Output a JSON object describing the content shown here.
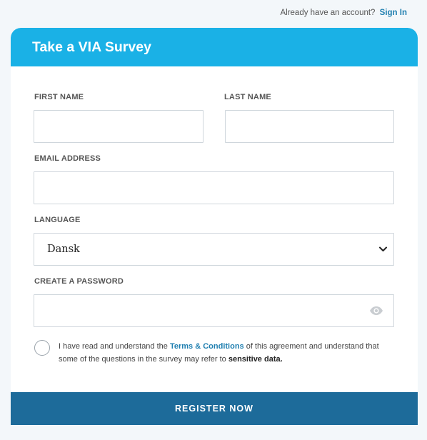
{
  "topbar": {
    "prompt": "Already have an account?",
    "signin_label": "Sign In"
  },
  "form": {
    "title": "Take a VIA Survey",
    "first_name_label": "FIRST NAME",
    "first_name_value": "",
    "last_name_label": "LAST NAME",
    "last_name_value": "",
    "email_label": "EMAIL ADDRESS",
    "email_value": "",
    "language_label": "LANGUAGE",
    "language_value": "Dansk",
    "password_label": "CREATE A PASSWORD",
    "password_value": "",
    "terms_prefix": "I have read and understand the",
    "terms_link": "Terms & Conditions",
    "terms_middle": "of this agreement and understand that some of the questions in the survey may refer to",
    "sensitive_link": "sensitive data.",
    "register_label": "REGISTER NOW"
  },
  "colors": {
    "header": "#1ab1e6",
    "button": "#1d6b9a",
    "link": "#1f7fb0",
    "background": "#f3f7fa"
  },
  "icons": {
    "select": "chevron-down-icon",
    "password": "eye-icon"
  }
}
